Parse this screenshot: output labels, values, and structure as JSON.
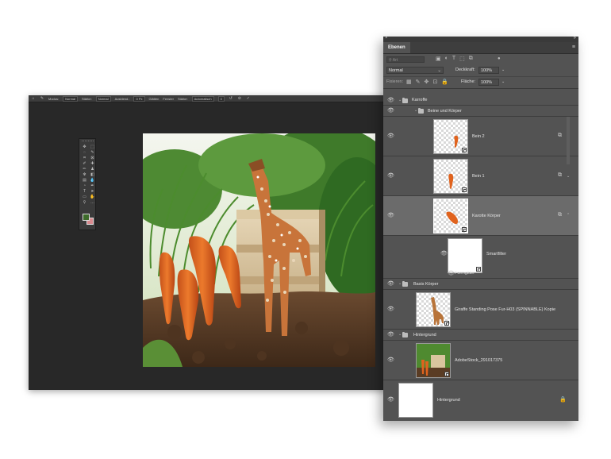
{
  "options_bar": {
    "items": [
      "Modus:",
      "Normal",
      "Stärke:",
      "Normal",
      "Ausblend.:",
      "0 Px",
      "Glätten",
      "Fenster",
      "Stärke:",
      "Automatisch",
      "0"
    ]
  },
  "toolbox": {
    "icons": [
      "move-icon",
      "marquee-icon",
      "lasso-icon",
      "quick-select-icon",
      "crop-icon",
      "frame-icon",
      "eyedropper-icon",
      "heal-icon",
      "brush-icon",
      "stamp-icon",
      "history-brush-icon",
      "eraser-icon",
      "gradient-icon",
      "blur-icon",
      "dodge-icon",
      "pen-icon",
      "type-icon",
      "path-select-icon",
      "shape-icon",
      "hand-icon",
      "zoom-icon",
      "more-icon"
    ],
    "glyphs": [
      "✥",
      "⬚",
      "◌",
      "✎",
      "⌗",
      "⊠",
      "✐",
      "✚",
      "✏",
      "♟",
      "✻",
      "◧",
      "▤",
      "💧",
      "◔",
      "✒",
      "T",
      "➤",
      "▭",
      "✋",
      "⚲",
      "…"
    ],
    "colors": {
      "foreground": "#3d6b2a",
      "background": "#d98a8f"
    }
  },
  "layers_panel": {
    "tab": "Ebenen",
    "filter_placeholder": "Art",
    "blend_mode": "Normal",
    "opacity_label": "Deckkraft:",
    "opacity_value": "100%",
    "lock_label": "Fixieren:",
    "fill_label": "Fläche:",
    "fill_value": "100%",
    "layers": [
      {
        "name": "Karroffe",
        "type": "group"
      },
      {
        "name": "Beine und Körper",
        "type": "group"
      },
      {
        "name": "Bein 2",
        "type": "smart-object"
      },
      {
        "name": "Bein 1",
        "type": "smart-object"
      },
      {
        "name": "Karotte Körper",
        "type": "smart-object",
        "selected": true
      },
      {
        "name": "Smartfilter",
        "type": "filter-mask"
      },
      {
        "name": "Formgitter",
        "type": "filter"
      },
      {
        "name": "Basis Körper",
        "type": "group"
      },
      {
        "name": "Giraffe Standing Pose Fur-H03 (SPINNABLE) Kopie",
        "type": "smart-object"
      },
      {
        "name": "Hintergrund",
        "type": "group"
      },
      {
        "name": "AdobeStock_291017375",
        "type": "smart-object"
      },
      {
        "name": "Hintergrund",
        "type": "background"
      }
    ]
  }
}
